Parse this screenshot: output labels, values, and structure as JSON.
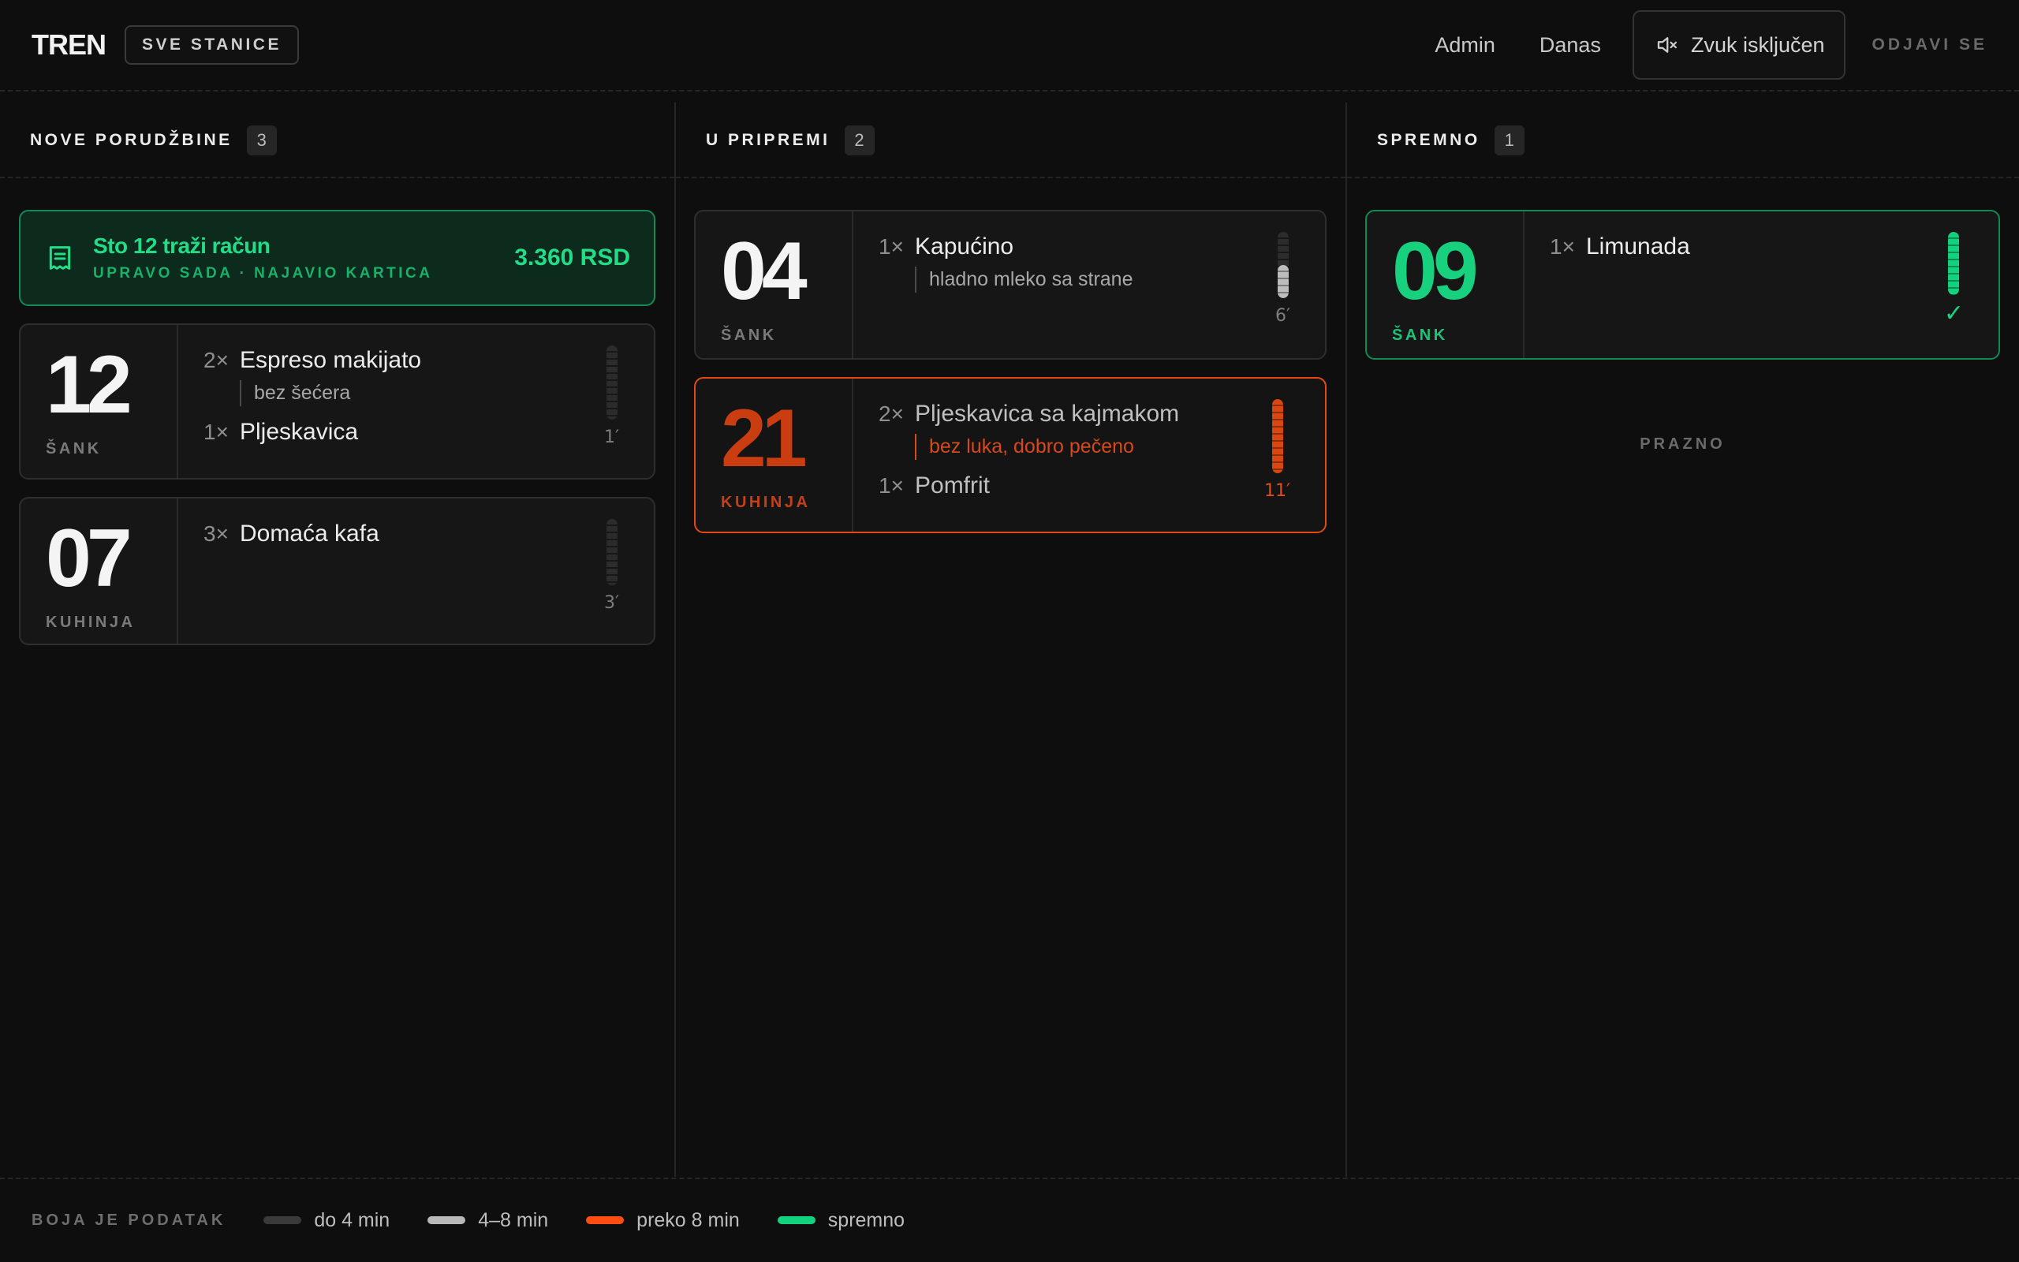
{
  "header": {
    "brand": "TREN",
    "station_button": "SVE STANICE",
    "nav": [
      "Admin",
      "Danas"
    ],
    "sound_label": "Zvuk isključen",
    "logout": "ODJAVI SE"
  },
  "columns": {
    "new": {
      "title": "NOVE PORUDŽBINE",
      "count": "3"
    },
    "prep": {
      "title": "U PRIPREMI",
      "count": "2"
    },
    "ready": {
      "title": "SPREMNO",
      "count": "1",
      "empty": "PRAZNO"
    }
  },
  "bill_request": {
    "title": "Sto 12 traži račun",
    "subtitle": "UPRAVO SADA · NAJAVIO KARTICA",
    "amount": "3.360 RSD"
  },
  "orders": {
    "o12": {
      "number": "12",
      "station": "ŠANK",
      "items": [
        {
          "qty": "2×",
          "name": "Espreso makijato",
          "note": "bez šećera"
        },
        {
          "qty": "1×",
          "name": "Pljeskavica"
        }
      ],
      "timer": "1′",
      "level": 0.0,
      "color": "#3a3a3a"
    },
    "o07": {
      "number": "07",
      "station": "KUHINJA",
      "items": [
        {
          "qty": "3×",
          "name": "Domaća kafa"
        }
      ],
      "timer": "3′",
      "level": 0.0,
      "color": "#3a3a3a"
    },
    "o04": {
      "number": "04",
      "station": "ŠANK",
      "items": [
        {
          "qty": "1×",
          "name": "Kapućino",
          "note": "hladno mleko sa strane"
        }
      ],
      "timer": "6′",
      "level": 0.5,
      "color": "#bdbdbd"
    },
    "o21": {
      "number": "21",
      "station": "KUHINJA",
      "items": [
        {
          "qty": "2×",
          "name": "Pljeskavica sa kajmakom",
          "note": "bez luka, dobro pečeno"
        },
        {
          "qty": "1×",
          "name": "Pomfrit"
        }
      ],
      "timer": "11′",
      "level": 1.0,
      "color": "#d9460f"
    },
    "o09": {
      "number": "09",
      "station": "ŠANK",
      "items": [
        {
          "qty": "1×",
          "name": "Limunada"
        }
      ],
      "check": "✓",
      "level": 1.0,
      "color": "#12d27e"
    }
  },
  "legend": {
    "title": "BOJA JE PODATAK",
    "items": [
      {
        "label": "do 4 min",
        "color": "#3a3a3a"
      },
      {
        "label": "4–8 min",
        "color": "#b8b8b8"
      },
      {
        "label": "preko 8 min",
        "color": "#ff4d12"
      },
      {
        "label": "spremno",
        "color": "#12d27e"
      }
    ]
  }
}
